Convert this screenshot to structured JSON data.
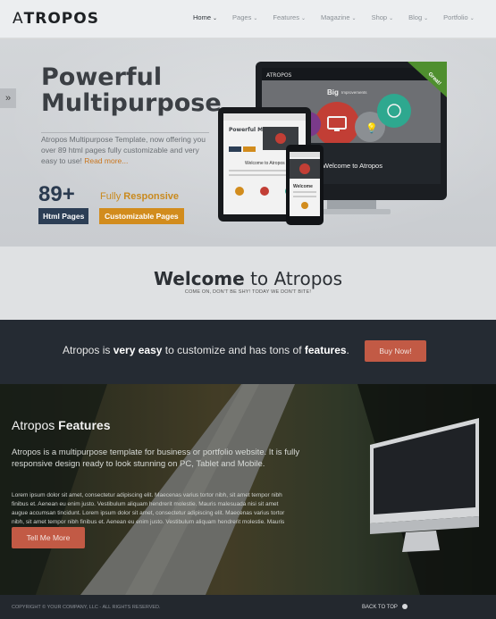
{
  "header": {
    "logo_first": "A",
    "logo_rest": "TROPOS",
    "nav": [
      {
        "label": "Home",
        "active": true
      },
      {
        "label": "Pages",
        "active": false
      },
      {
        "label": "Features",
        "active": false
      },
      {
        "label": "Magazine",
        "active": false
      },
      {
        "label": "Shop",
        "active": false
      },
      {
        "label": "Blog",
        "active": false
      },
      {
        "label": "Portfolio",
        "active": false
      }
    ]
  },
  "hero": {
    "title_line1": "Powerful",
    "title_line2": "Multipurpose",
    "description": "Atropos Multipurpose Template, now offering you over 89 html pages fully customizable and very easy to use!",
    "read_more": "Read more...",
    "number": "89+",
    "fully_prefix": "Fully",
    "fully_bold": "Responsive",
    "pill_html": "Html Pages",
    "pill_custom": "Customizable Pages",
    "badge_great": "Great!",
    "screen_logo": "ATROPOS",
    "screen_big": "Big",
    "screen_impact": "Improvements",
    "screen_welcome": "Welcome to Atropos",
    "screen_power": "Powerful Multipurpose",
    "tablet_welcome": "Welcome to Atropos",
    "phone_welcome": "Welcome",
    "side_tab": "»"
  },
  "welcome": {
    "title_bold": "Welcome",
    "title_rest": " to Atropos",
    "subtitle": "COME ON, DON'T BE SHY! TODAY WE DON'T BITE!"
  },
  "cta": {
    "text_1": "Atropos is ",
    "text_bold1": "very easy",
    "text_2": " to customize and has tons of ",
    "text_bold2": "features",
    "text_3": ".",
    "button": "Buy Now!"
  },
  "features": {
    "title_plain": "Atropos ",
    "title_bold": "Features",
    "p1": "Atropos is a multipurpose template for business or portfolio website. It is fully responsive design ready to look stunning on PC, Tablet and Mobile.",
    "p2": "Lorem ipsum dolor sit amet, consectetur adipiscing elit. Maecenas varius tortor nibh, sit amet tempor nibh finibus et. Aenean eu enim justo. Vestibulum aliquam hendrerit molestie. Mauris malesuada nisi sit amet augue accumsan tincidunt. Lorem ipsum dolor sit amet, consectetur adipiscing elit. Maecenas varius tortor nibh, sit amet tempor nibh finibus et. Aenean eu enim justo. Vestibulum aliquam hendrerit molestie. Mauris malesuada nisi sit amet augue accumsan tincidunt.",
    "button": "Tell Me More"
  },
  "footer": {
    "copyright": "COPYRIGHT © YOUR COMPANY, LLC - ALL RIGHTS RESERVED.",
    "back_to_top": "BACK TO TOP"
  },
  "colors": {
    "accent": "#c25a45",
    "navy": "#2c3e55",
    "gold": "#d28c1d",
    "dark": "#252b33"
  }
}
